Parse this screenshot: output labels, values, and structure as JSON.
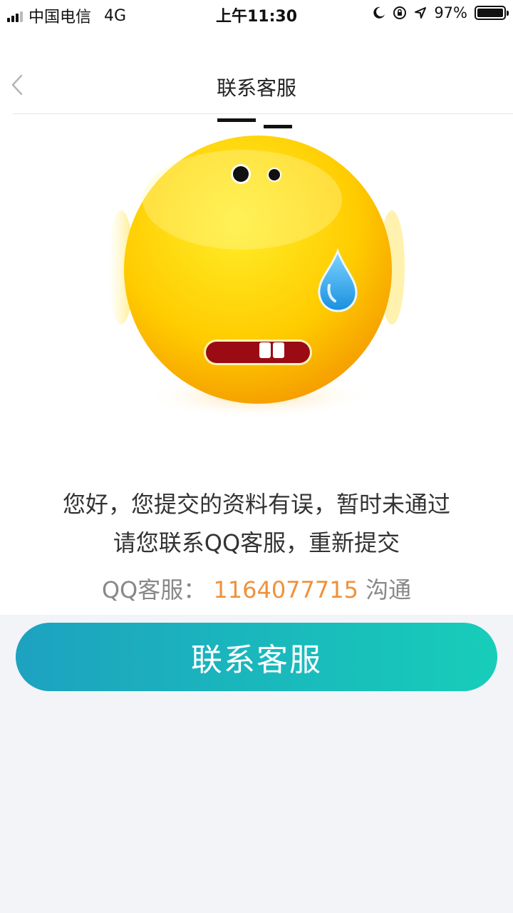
{
  "status_bar": {
    "carrier": "中国电信",
    "network": "4G",
    "time": "上午11:30",
    "battery": "97%"
  },
  "nav": {
    "title": "联系客服"
  },
  "message": {
    "line1": "您好，您提交的资料有误，暂时未通过",
    "line2": "请您联系QQ客服，重新提交"
  },
  "contact": {
    "label": "QQ客服：",
    "number": "1164077715",
    "suffix": "沟通"
  },
  "button": {
    "label": "联系客服"
  },
  "colors": {
    "accent_orange": "#f0913b",
    "button_start": "#1da2c0",
    "button_end": "#17cdb9",
    "background": "#f2f4f8"
  },
  "icons": [
    "back-chevron-icon",
    "signal-icon",
    "moon-icon",
    "rotation-lock-icon",
    "location-icon",
    "battery-icon",
    "sweating-emoji-icon"
  ]
}
